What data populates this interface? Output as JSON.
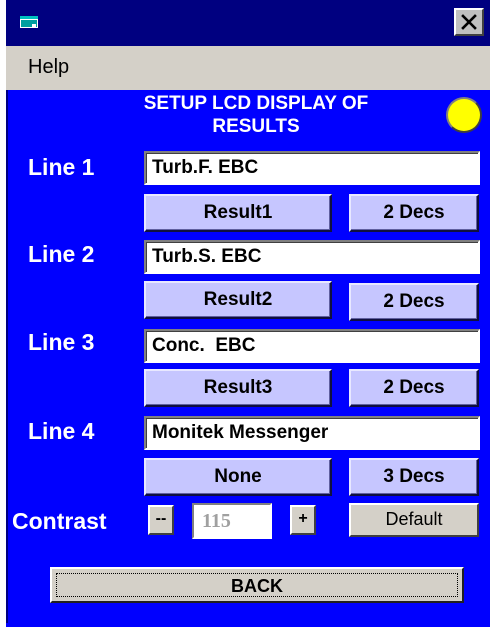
{
  "titlebar": {
    "close_glyph": "✕",
    "app_icon": "app-window-icon"
  },
  "menu": {
    "help": "Help"
  },
  "heading": {
    "line1": "SETUP LCD DISPLAY OF",
    "line2": "RESULTS"
  },
  "status_led": {
    "color": "#ffff00"
  },
  "lines": [
    {
      "label": "Line 1",
      "text": "Turb.F. EBC",
      "result": "Result1",
      "decs": "2 Decs"
    },
    {
      "label": "Line 2",
      "text": "Turb.S. EBC",
      "result": "Result2",
      "decs": "2 Decs"
    },
    {
      "label": "Line 3",
      "text": "Conc.  EBC",
      "result": "Result3",
      "decs": "2 Decs"
    },
    {
      "label": "Line 4",
      "text": "Monitek Messenger",
      "result": "None",
      "decs": "3 Decs"
    }
  ],
  "contrast": {
    "label": "Contrast",
    "decrease": "--",
    "value": "115",
    "increase": "+",
    "default": "Default"
  },
  "back": "BACK",
  "colors": {
    "panel": "#0000ff",
    "titlebar": "#000080",
    "button": "#c6c6ff"
  }
}
